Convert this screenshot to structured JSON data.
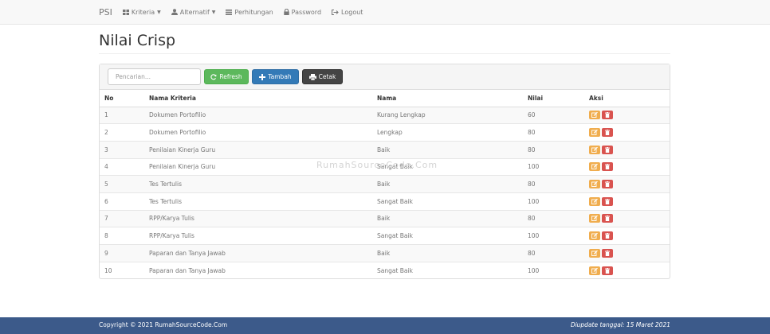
{
  "navbar": {
    "brand": "PSI",
    "items": [
      {
        "label": "Kriteria",
        "icon": "grid-icon",
        "dropdown": true
      },
      {
        "label": "Alternatif",
        "icon": "user-icon",
        "dropdown": true
      },
      {
        "label": "Perhitungan",
        "icon": "list-icon",
        "dropdown": false
      },
      {
        "label": "Password",
        "icon": "lock-icon",
        "dropdown": false
      },
      {
        "label": "Logout",
        "icon": "logout-icon",
        "dropdown": false
      }
    ]
  },
  "page": {
    "title": "Nilai Crisp"
  },
  "toolbar": {
    "search_placeholder": "Pencarian...",
    "refresh_label": "Refresh",
    "add_label": "Tambah",
    "print_label": "Cetak"
  },
  "table": {
    "headers": [
      "No",
      "Nama Kriteria",
      "Nama",
      "Nilai",
      "Aksi"
    ],
    "rows": [
      {
        "no": "1",
        "kriteria": "Dokumen Portofilio",
        "nama": "Kurang Lengkap",
        "nilai": "60"
      },
      {
        "no": "2",
        "kriteria": "Dokumen Portofilio",
        "nama": "Lengkap",
        "nilai": "80"
      },
      {
        "no": "3",
        "kriteria": "Penilaian Kinerja Guru",
        "nama": "Baik",
        "nilai": "80"
      },
      {
        "no": "4",
        "kriteria": "Penilaian Kinerja Guru",
        "nama": "Sangat Baik",
        "nilai": "100"
      },
      {
        "no": "5",
        "kriteria": "Tes Tertulis",
        "nama": "Baik",
        "nilai": "80"
      },
      {
        "no": "6",
        "kriteria": "Tes Tertulis",
        "nama": "Sangat Baik",
        "nilai": "100"
      },
      {
        "no": "7",
        "kriteria": "RPP/Karya Tulis",
        "nama": "Baik",
        "nilai": "80"
      },
      {
        "no": "8",
        "kriteria": "RPP/Karya Tulis",
        "nama": "Sangat Baik",
        "nilai": "100"
      },
      {
        "no": "9",
        "kriteria": "Paparan dan Tanya Jawab",
        "nama": "Baik",
        "nilai": "80"
      },
      {
        "no": "10",
        "kriteria": "Paparan dan Tanya Jawab",
        "nama": "Sangat Baik",
        "nilai": "100"
      }
    ]
  },
  "watermark": "RumahSourceCode.Com",
  "footer": {
    "copyright": "Copyright © 2021 RumahSourceCode.Com",
    "updated": "Diupdate tanggal: 15 Maret 2021"
  },
  "colors": {
    "refresh": "#5cb85c",
    "add": "#337ab7",
    "print": "#444444",
    "edit": "#f0ad4e",
    "delete": "#d9534f",
    "footer": "#3c5a8a"
  }
}
